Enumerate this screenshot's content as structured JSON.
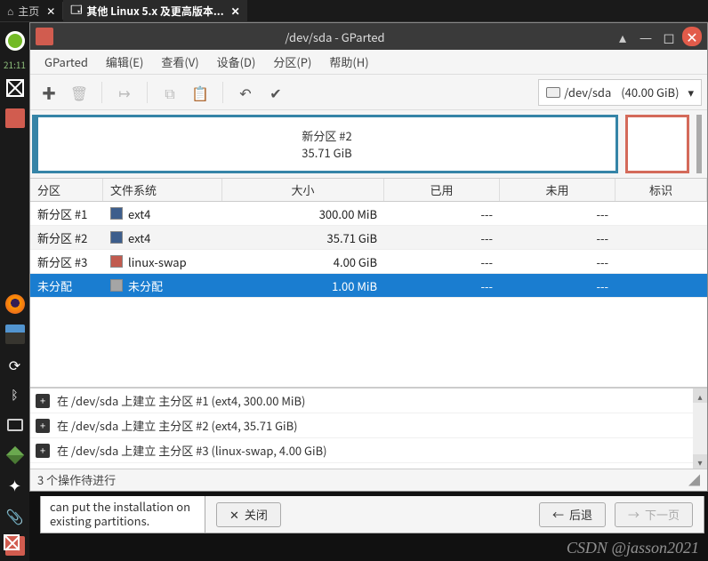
{
  "top_tabs": {
    "home": "主页",
    "vm": "其他 Linux 5.x 及更高版本..."
  },
  "dock_time": "21:11",
  "gparted": {
    "title": "/dev/sda - GParted",
    "menu": {
      "gparted": "GParted",
      "edit": "编辑(E)",
      "view": "查看(V)",
      "device": "设备(D)",
      "partition": "分区(P)",
      "help": "帮助(H)"
    },
    "device": {
      "name": "/dev/sda",
      "size": "(40.00 GiB)"
    },
    "map": {
      "main_name": "新分区 #2",
      "main_size": "35.71 GiB"
    },
    "cols": {
      "partition": "分区",
      "filesystem": "文件系统",
      "size": "大小",
      "used": "已用",
      "free": "未用",
      "flags": "标识"
    },
    "rows": [
      {
        "name": "新分区 #1",
        "fs": "ext4",
        "sw": "ext4",
        "size": "300.00 MiB",
        "used": "---",
        "free": "---",
        "flags": ""
      },
      {
        "name": "新分区 #2",
        "fs": "ext4",
        "sw": "ext4",
        "size": "35.71 GiB",
        "used": "---",
        "free": "---",
        "flags": ""
      },
      {
        "name": "新分区 #3",
        "fs": "linux-swap",
        "sw": "swap",
        "size": "4.00 GiB",
        "used": "---",
        "free": "---",
        "flags": ""
      },
      {
        "name": "未分配",
        "fs": "未分配",
        "sw": "unalloc-sw",
        "size": "1.00 MiB",
        "used": "---",
        "free": "---",
        "flags": ""
      }
    ],
    "ops": [
      "在 /dev/sda 上建立 主分区 #1 (ext4, 300.00 MiB)",
      "在 /dev/sda 上建立 主分区 #2 (ext4, 35.71 GiB)",
      "在 /dev/sda 上建立 主分区 #3 (linux-swap, 4.00 GiB)"
    ],
    "status": "3 个操作待进行"
  },
  "installer": {
    "note": "can put the installation on existing partitions.",
    "close": "关闭",
    "back": "后退",
    "next": "下一页"
  },
  "watermark": "CSDN @jasson2021"
}
